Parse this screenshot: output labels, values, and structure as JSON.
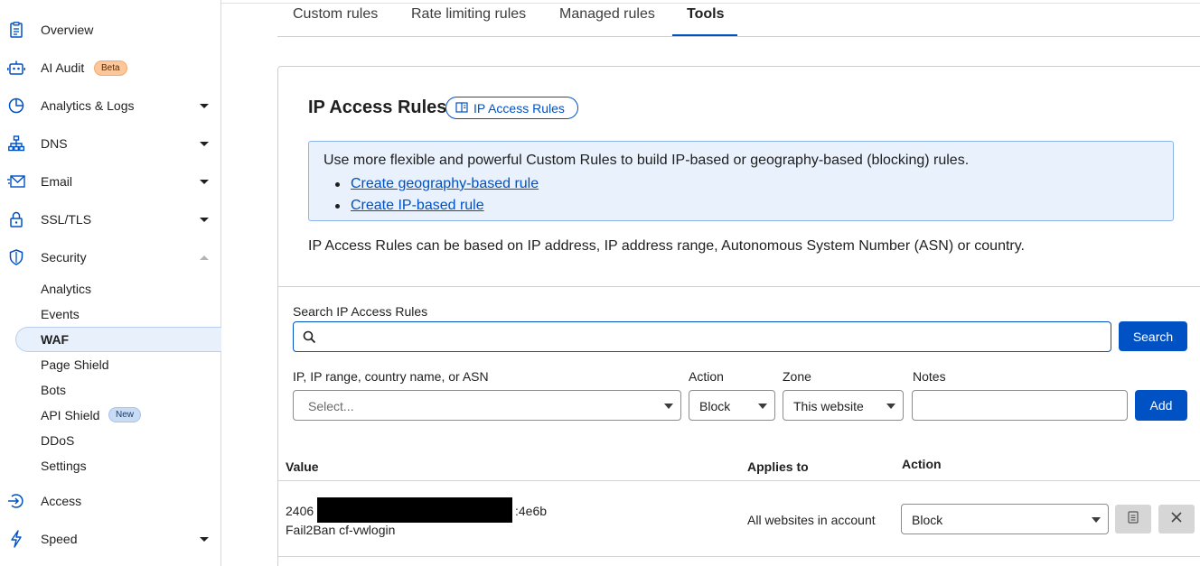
{
  "sidebar": {
    "items": [
      {
        "label": "Overview",
        "icon": "document-icon"
      },
      {
        "label": "AI Audit",
        "icon": "robot-icon",
        "badge": "Beta"
      },
      {
        "label": "Analytics & Logs",
        "icon": "chart-pie-icon"
      },
      {
        "label": "DNS",
        "icon": "network-icon"
      },
      {
        "label": "Email",
        "icon": "envelope-icon"
      },
      {
        "label": "SSL/TLS",
        "icon": "lock-icon"
      },
      {
        "label": "Security",
        "icon": "shield-icon"
      },
      {
        "label": "Access",
        "icon": "access-icon"
      },
      {
        "label": "Speed",
        "icon": "lightning-icon"
      }
    ],
    "security_sub": [
      {
        "label": "Analytics"
      },
      {
        "label": "Events"
      },
      {
        "label": "WAF",
        "active": true
      },
      {
        "label": "Page Shield"
      },
      {
        "label": "Bots"
      },
      {
        "label": "API Shield",
        "badge": "New"
      },
      {
        "label": "DDoS"
      },
      {
        "label": "Settings"
      }
    ]
  },
  "tabs": [
    {
      "label": "Custom rules"
    },
    {
      "label": "Rate limiting rules"
    },
    {
      "label": "Managed rules"
    },
    {
      "label": "Tools",
      "active": true
    }
  ],
  "card": {
    "title": "IP Access Rules",
    "doc_link": "IP Access Rules",
    "info_text": "Use more flexible and powerful Custom Rules to build IP-based or geography-based (blocking) rules.",
    "info_links": [
      "Create geography-based rule",
      "Create IP-based rule"
    ],
    "description": "IP Access Rules can be based on IP address, IP address range, Autonomous System Number (ASN) or country."
  },
  "search": {
    "label": "Search IP Access Rules",
    "value": "",
    "button": "Search"
  },
  "add_form": {
    "ip_label": "IP, IP range, country name, or ASN",
    "ip_placeholder": "Select...",
    "action_label": "Action",
    "action_value": "Block",
    "zone_label": "Zone",
    "zone_value": "This website",
    "notes_label": "Notes",
    "notes_value": "",
    "add_button": "Add"
  },
  "table": {
    "headers": [
      "Value",
      "Applies to",
      "Action"
    ],
    "rows": [
      {
        "value_prefix": "2406",
        "value_suffix": ":4e6b",
        "note": "Fail2Ban cf-vwlogin",
        "applies_to": "All websites in account",
        "action": "Block"
      }
    ]
  },
  "colors": {
    "accent": "#0051c3",
    "info_bg": "#e8f1fc",
    "beta_badge": "#fbc79b",
    "new_badge": "#c9dcf5"
  }
}
